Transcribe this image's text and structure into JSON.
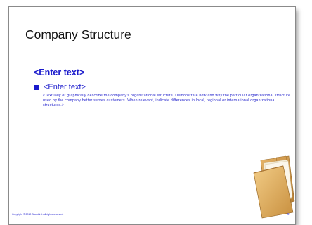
{
  "slide": {
    "title": "Company Structure",
    "subtitle": "<Enter text>",
    "bullet": "<Enter text>",
    "body": "<Textually or graphically describe the company's organizational structure. Demonstrate how and why the particular organizational structure used by the company better serves customers. When relevant, indicate differences in local, regional or international organizational structures.>",
    "copyright": "Copyright © 2010 Blackbird. All rights reserved.",
    "page_number": "9",
    "folder_icon": "folder-icon"
  },
  "colors": {
    "accent": "#1a1acc",
    "title": "#111111",
    "folder": "#d9a85a"
  }
}
